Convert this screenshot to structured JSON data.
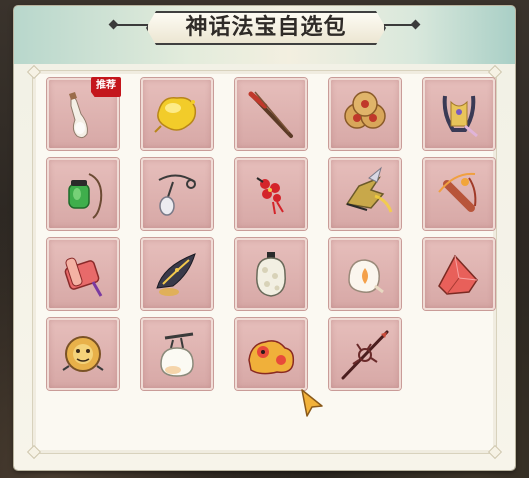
{
  "panel": {
    "title": "神话法宝自选包"
  },
  "grid": {
    "items": [
      {
        "name": "white-bottle-gourd",
        "badge": "推荐"
      },
      {
        "name": "golden-ore-lump",
        "badge": ""
      },
      {
        "name": "red-chopstick-blade",
        "badge": ""
      },
      {
        "name": "triple-copper-coins",
        "badge": ""
      },
      {
        "name": "golden-horned-crown",
        "badge": ""
      },
      {
        "name": "jade-green-pouch",
        "badge": ""
      },
      {
        "name": "silver-pendant-charm",
        "badge": ""
      },
      {
        "name": "red-chinese-knot",
        "badge": ""
      },
      {
        "name": "winged-golden-boot",
        "badge": ""
      },
      {
        "name": "flaming-bow",
        "badge": ""
      },
      {
        "name": "red-scroll-bundle",
        "badge": ""
      },
      {
        "name": "dark-feather-fan",
        "badge": ""
      },
      {
        "name": "pearl-bead-gourd",
        "badge": ""
      },
      {
        "name": "white-flame-shell",
        "badge": ""
      },
      {
        "name": "red-crystal-stone",
        "badge": ""
      },
      {
        "name": "sun-mirror-disc",
        "badge": ""
      },
      {
        "name": "white-bun-bag",
        "badge": ""
      },
      {
        "name": "gold-lion-figure",
        "badge": ""
      },
      {
        "name": "thorned-dark-spear",
        "badge": ""
      }
    ]
  }
}
